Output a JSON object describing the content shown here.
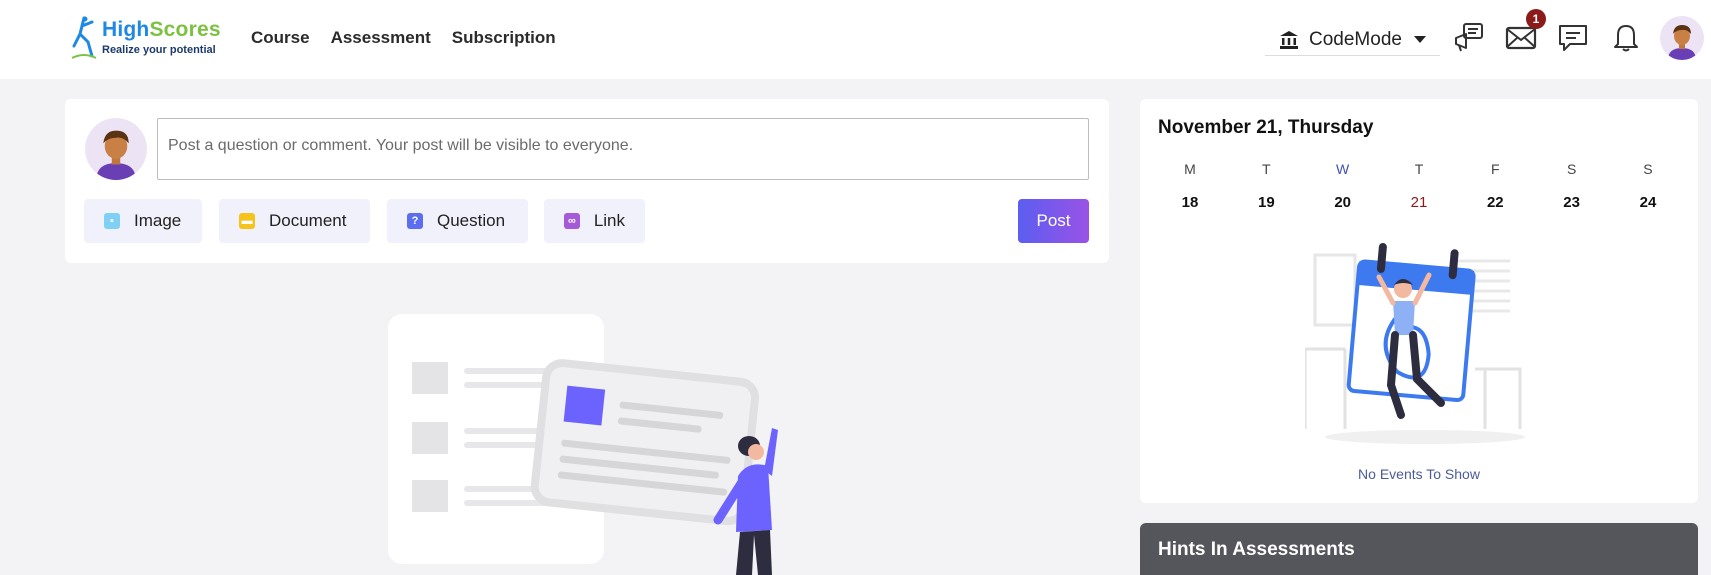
{
  "header": {
    "logo": {
      "title_a": "High",
      "title_b": "Scores",
      "tagline": "Realize your potential"
    },
    "nav": [
      "Course",
      "Assessment",
      "Subscription"
    ],
    "mode_selector": "CodeMode",
    "mail_badge": "1"
  },
  "post": {
    "placeholder": "Post a question or comment. Your post will be visible to everyone.",
    "attachments": [
      "Image",
      "Document",
      "Question",
      "Link"
    ],
    "post_label": "Post"
  },
  "calendar": {
    "title": "November 21, Thursday",
    "weekdays": [
      "M",
      "T",
      "W",
      "T",
      "F",
      "S",
      "S"
    ],
    "dates": [
      "18",
      "19",
      "20",
      "21",
      "22",
      "23",
      "24"
    ],
    "empty_text": "No Events To Show"
  },
  "hints": {
    "title": "Hints In Assessments"
  },
  "colors": {
    "accent_start": "#5b5ef0",
    "accent_end": "#9a52e6",
    "today": "#8b1a1a",
    "badge": "#8b1a1a"
  }
}
